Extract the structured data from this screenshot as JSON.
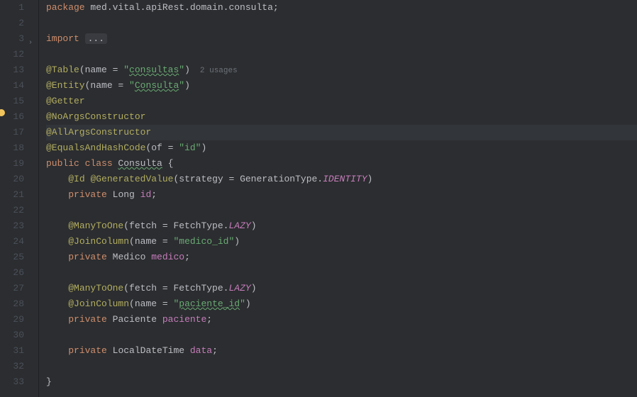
{
  "lines": [
    {
      "num": "1",
      "tokens": [
        {
          "t": "package ",
          "c": "keyword"
        },
        {
          "t": "med.vital.apiRest.domain.consulta;",
          "c": "type"
        }
      ]
    },
    {
      "num": "2",
      "tokens": []
    },
    {
      "num": "3",
      "fold": true,
      "tokens": [
        {
          "t": "import ",
          "c": "keyword"
        },
        {
          "t": "...",
          "c": "fold-box"
        }
      ]
    },
    {
      "num": "12",
      "tokens": []
    },
    {
      "num": "13",
      "tokens": [
        {
          "t": "@Table",
          "c": "annotation"
        },
        {
          "t": "(name = ",
          "c": "punct"
        },
        {
          "t": "\"",
          "c": "string"
        },
        {
          "t": "consultas",
          "c": "string string-underline"
        },
        {
          "t": "\"",
          "c": "string"
        },
        {
          "t": ")",
          "c": "punct"
        }
      ],
      "hint": "2 usages"
    },
    {
      "num": "14",
      "tokens": [
        {
          "t": "@Entity",
          "c": "annotation"
        },
        {
          "t": "(name = ",
          "c": "punct"
        },
        {
          "t": "\"",
          "c": "string"
        },
        {
          "t": "Consulta",
          "c": "string string-underline"
        },
        {
          "t": "\"",
          "c": "string"
        },
        {
          "t": ")",
          "c": "punct"
        }
      ]
    },
    {
      "num": "15",
      "tokens": [
        {
          "t": "@Getter",
          "c": "annotation"
        }
      ]
    },
    {
      "num": "16",
      "tokens": [
        {
          "t": "@NoArgsConstructor",
          "c": "annotation"
        }
      ]
    },
    {
      "num": "17",
      "highlight": true,
      "tokens": [
        {
          "t": "@AllArgsConstructor",
          "c": "annotation"
        }
      ]
    },
    {
      "num": "18",
      "tokens": [
        {
          "t": "@EqualsAndHashCode",
          "c": "annotation"
        },
        {
          "t": "(of = ",
          "c": "punct"
        },
        {
          "t": "\"id\"",
          "c": "string"
        },
        {
          "t": ")",
          "c": "punct"
        }
      ]
    },
    {
      "num": "19",
      "tokens": [
        {
          "t": "public class ",
          "c": "keyword"
        },
        {
          "t": "Consulta",
          "c": "class-name class-underline"
        },
        {
          "t": " {",
          "c": "punct"
        }
      ]
    },
    {
      "num": "20",
      "indent": 1,
      "tokens": [
        {
          "t": "@Id ",
          "c": "annotation"
        },
        {
          "t": "@GeneratedValue",
          "c": "annotation"
        },
        {
          "t": "(strategy = GenerationType.",
          "c": "punct"
        },
        {
          "t": "IDENTITY",
          "c": "static-field"
        },
        {
          "t": ")",
          "c": "punct"
        }
      ]
    },
    {
      "num": "21",
      "indent": 1,
      "tokens": [
        {
          "t": "private ",
          "c": "keyword"
        },
        {
          "t": "Long ",
          "c": "type"
        },
        {
          "t": "id",
          "c": "field"
        },
        {
          "t": ";",
          "c": "punct"
        }
      ]
    },
    {
      "num": "22",
      "tokens": []
    },
    {
      "num": "23",
      "indent": 1,
      "tokens": [
        {
          "t": "@ManyToOne",
          "c": "annotation"
        },
        {
          "t": "(fetch = FetchType.",
          "c": "punct"
        },
        {
          "t": "LAZY",
          "c": "static-field"
        },
        {
          "t": ")",
          "c": "punct"
        }
      ]
    },
    {
      "num": "24",
      "indent": 1,
      "tokens": [
        {
          "t": "@JoinColumn",
          "c": "annotation"
        },
        {
          "t": "(name = ",
          "c": "punct"
        },
        {
          "t": "\"medico_id\"",
          "c": "string"
        },
        {
          "t": ")",
          "c": "punct"
        }
      ]
    },
    {
      "num": "25",
      "indent": 1,
      "tokens": [
        {
          "t": "private ",
          "c": "keyword"
        },
        {
          "t": "Medico ",
          "c": "type"
        },
        {
          "t": "medico",
          "c": "field"
        },
        {
          "t": ";",
          "c": "punct"
        }
      ]
    },
    {
      "num": "26",
      "tokens": []
    },
    {
      "num": "27",
      "indent": 1,
      "tokens": [
        {
          "t": "@ManyToOne",
          "c": "annotation"
        },
        {
          "t": "(fetch = FetchType.",
          "c": "punct"
        },
        {
          "t": "LAZY",
          "c": "static-field"
        },
        {
          "t": ")",
          "c": "punct"
        }
      ]
    },
    {
      "num": "28",
      "indent": 1,
      "tokens": [
        {
          "t": "@JoinColumn",
          "c": "annotation"
        },
        {
          "t": "(name = ",
          "c": "punct"
        },
        {
          "t": "\"",
          "c": "string"
        },
        {
          "t": "paciente_id",
          "c": "string string-underline"
        },
        {
          "t": "\"",
          "c": "string"
        },
        {
          "t": ")",
          "c": "punct"
        }
      ]
    },
    {
      "num": "29",
      "indent": 1,
      "tokens": [
        {
          "t": "private ",
          "c": "keyword"
        },
        {
          "t": "Paciente ",
          "c": "type"
        },
        {
          "t": "paciente",
          "c": "field"
        },
        {
          "t": ";",
          "c": "punct"
        }
      ]
    },
    {
      "num": "30",
      "tokens": []
    },
    {
      "num": "31",
      "indent": 1,
      "tokens": [
        {
          "t": "private ",
          "c": "keyword"
        },
        {
          "t": "LocalDateTime ",
          "c": "type"
        },
        {
          "t": "data",
          "c": "field"
        },
        {
          "t": ";",
          "c": "punct"
        }
      ]
    },
    {
      "num": "32",
      "tokens": []
    },
    {
      "num": "33",
      "tokens": [
        {
          "t": "}",
          "c": "punct"
        }
      ]
    }
  ]
}
